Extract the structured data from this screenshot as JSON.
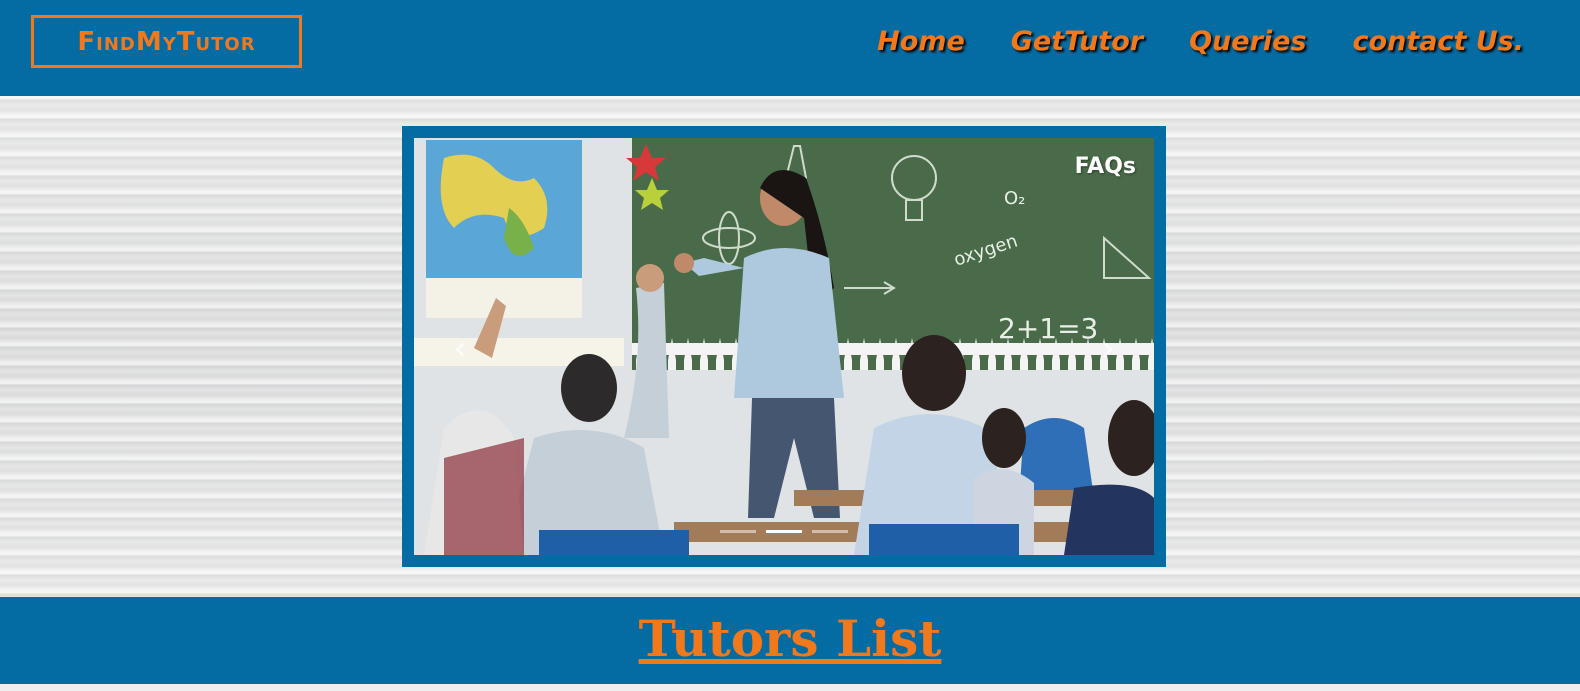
{
  "header": {
    "logo_text": "FindMyTutor",
    "nav": [
      {
        "label": "Home"
      },
      {
        "label": "GetTutor"
      },
      {
        "label": "Queries"
      },
      {
        "label": "contact Us."
      }
    ]
  },
  "carousel": {
    "badge": "FAQs",
    "prev_icon": "chevron-left-icon",
    "next_icon": "chevron-right-icon",
    "indicator_count": 3,
    "active_index": 1,
    "chalkboard_text": [
      "O₂",
      "oxygen",
      "2+1=3"
    ]
  },
  "main": {
    "section_title": "Tutors List"
  },
  "colors": {
    "brand_blue": "#046ba3",
    "accent_orange": "#f2781c"
  }
}
